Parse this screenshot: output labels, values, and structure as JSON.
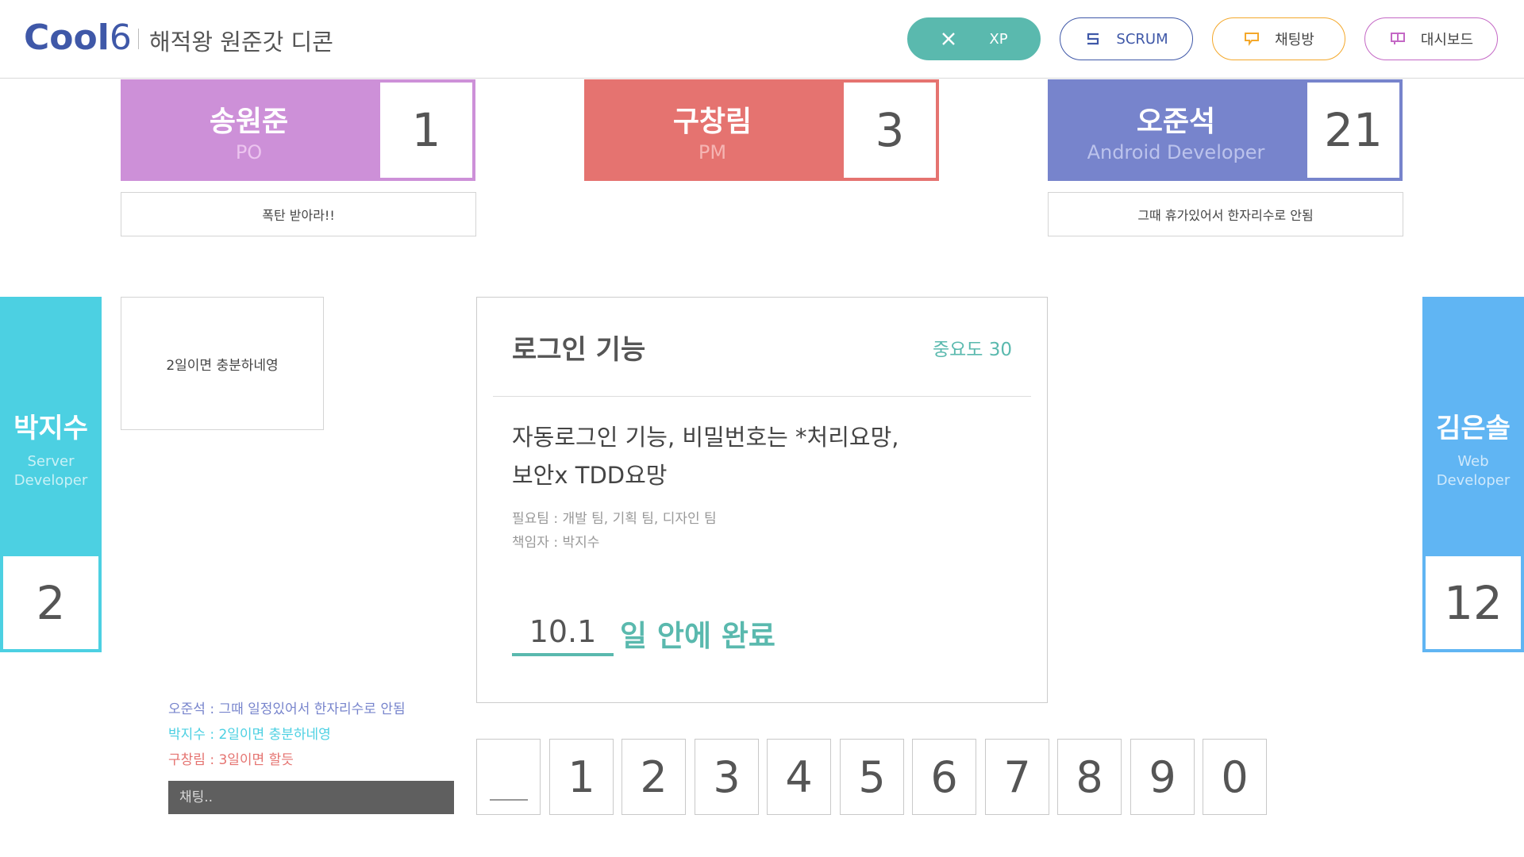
{
  "header": {
    "logo_text": "Cool",
    "logo_suffix": "6",
    "room_title": "해적왕 원준갓 디콘",
    "buttons": [
      {
        "label": "XP",
        "icon": "cross-icon"
      },
      {
        "label": "SCRUM",
        "icon": "s-icon"
      },
      {
        "label": "채팅방",
        "icon": "chat-bubble-icon"
      },
      {
        "label": "대시보드",
        "icon": "dashboard-icon"
      }
    ]
  },
  "colors": {
    "brand": "#3f58a8",
    "teal": "#5ab9ae",
    "po": "#cd90d8",
    "pm": "#e57370",
    "android": "#7784cc",
    "server": "#4cd0e2",
    "web": "#60b5f3"
  },
  "players": {
    "top": [
      {
        "name": "송원준",
        "role": "PO",
        "score": "1",
        "message": "폭탄 받아라!!"
      },
      {
        "name": "구창림",
        "role": "PM",
        "score": "3",
        "message": ""
      },
      {
        "name": "오준석",
        "role": "Android Developer",
        "score": "21",
        "message": "그때 휴가있어서 한자리수로 안됨"
      }
    ],
    "left": {
      "name": "박지수",
      "role": "Server Developer",
      "score": "2",
      "message": "2일이면 충분하네영"
    },
    "right": {
      "name": "김은솔",
      "role": "Web Developer",
      "score": "12"
    }
  },
  "task": {
    "title": "로그인 기능",
    "importance": "중요도 30",
    "description_line1": "자동로그인 기능, 비밀번호는 *처리요망,",
    "description_line2": "보안x TDD요망",
    "teams": "필요팀 : 개발 팀, 기획 팀, 디자인 팀",
    "owner": "책임자 : 박지수",
    "due_value": "10.1",
    "due_text": "일 안에 완료"
  },
  "chat": {
    "messages": [
      {
        "text": "오준석 : 그때 일정있어서 한자리수로 안됨",
        "color": "#7784cc"
      },
      {
        "text": "박지수 : 2일이면 충분하네영",
        "color": "#4cd0e2"
      },
      {
        "text": "구창림 : 3일이면 할듯",
        "color": "#e57370"
      }
    ],
    "placeholder": "채팅.."
  },
  "vote_keys": [
    "1",
    "2",
    "3",
    "4",
    "5",
    "6",
    "7",
    "8",
    "9",
    "0"
  ]
}
